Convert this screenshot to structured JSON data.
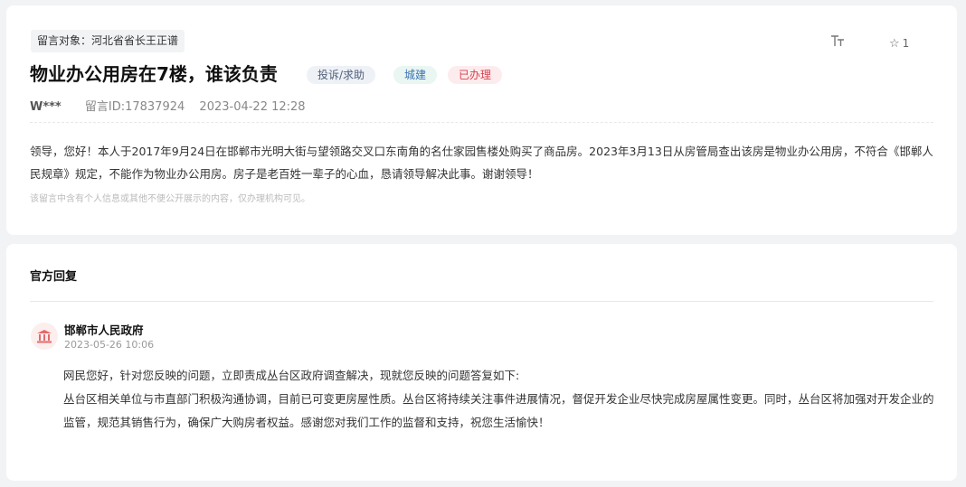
{
  "message": {
    "target_label": "留言对象：河北省省长王正谱",
    "title": "物业办公用房在7楼，谁该负责",
    "badges": {
      "type": "投诉/求助",
      "category": "城建",
      "status": "已办理"
    },
    "toolbar": {
      "font_size_label": "TT",
      "favorite_count": "1"
    },
    "author": "W***",
    "message_id": "留言ID:17837924",
    "datetime": "2023-04-22 12:28",
    "content": "领导，您好！本人于2017年9月24日在邯郸市光明大街与望领路交叉口东南角的名仕家园售楼处购买了商品房。2023年3月13日从房管局查出该房是物业办公用房，不符合《邯郸人民规章》规定，不能作为物业办公用房。房子是老百姓一辈子的心血，恳请领导解决此事。谢谢领导！",
    "privacy_notice": "该留言中含有个人信息或其他不便公开展示的内容，仅办理机构可见。"
  },
  "reply": {
    "heading": "官方回复",
    "replier": "邯郸市人民政府",
    "date": "2023-05-26 10:06",
    "lines": [
      "网民您好，针对您反映的问题，立即责成丛台区政府调查解决，现就您反映的问题答复如下:",
      "丛台区相关单位与市直部门积极沟通协调，目前已可变更房屋性质。丛台区将持续关注事件进展情况，督促开发企业尽快完成房屋属性变更。同时，丛台区将加强对开发企业的监管，规范其销售行为，确保广大购房者权益。感谢您对我们工作的监督和支持，祝您生活愉快！"
    ]
  },
  "colors": {
    "background": "#f2f3f5",
    "status_red": "#d9414d",
    "category_blue": "#3c72b6",
    "avatar_red": "#e46a6a"
  },
  "icons": {
    "font_size": "font-size-icon",
    "favorite": "star-outline-icon",
    "avatar": "government-building-icon"
  }
}
